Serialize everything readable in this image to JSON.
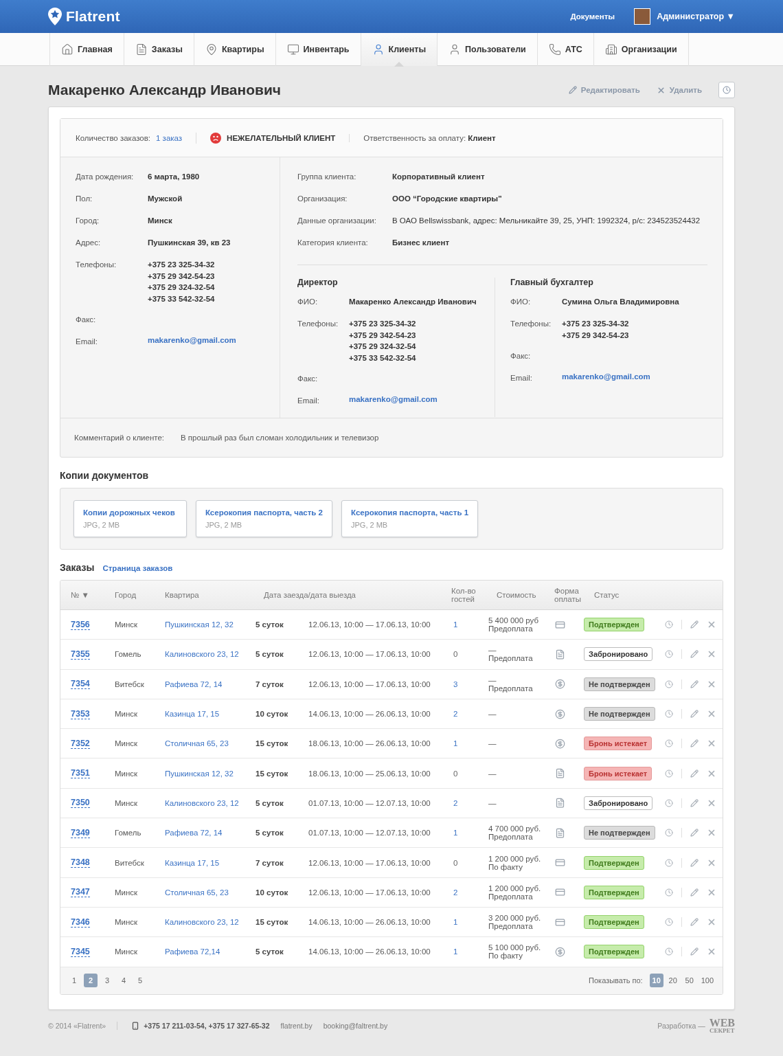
{
  "header": {
    "logo": "Flatrent",
    "documents_link": "Документы",
    "user_name": "Администратор ▼"
  },
  "nav": [
    {
      "label": "Главная",
      "kind": "home",
      "selected": false
    },
    {
      "label": "Заказы",
      "kind": "orders",
      "selected": false
    },
    {
      "label": "Квартиры",
      "kind": "apartments",
      "selected": false
    },
    {
      "label": "Инвентарь",
      "kind": "inventory",
      "selected": false
    },
    {
      "label": "Клиенты",
      "kind": "clients",
      "selected": true
    },
    {
      "label": "Пользователи",
      "kind": "users",
      "selected": false
    },
    {
      "label": "АТС",
      "kind": "telephony",
      "selected": false
    },
    {
      "label": "Организации",
      "kind": "organizations",
      "selected": false
    }
  ],
  "page": {
    "title": "Макаренко Александр Иванович",
    "actions": [
      {
        "label": "Редактировать",
        "kind": "edit"
      },
      {
        "label": "Удалить",
        "kind": "delete"
      }
    ]
  },
  "summary": {
    "orders_label": "Количество заказов:",
    "orders_value": "1 заказ",
    "warning": "НЕЖЕЛАТЕЛЬНЫЙ КЛИЕНТ",
    "payment_label": "Ответственность за оплату:",
    "payment_value": "Клиент"
  },
  "personal": [
    {
      "label": "Дата рождения:",
      "values": [
        "6 марта, 1980"
      ],
      "kind": "text"
    },
    {
      "label": "Пол:",
      "values": [
        "Мужской"
      ],
      "kind": "text"
    },
    {
      "label": "Город:",
      "values": [
        "Минск"
      ],
      "kind": "text"
    },
    {
      "label": "Адрес:",
      "values": [
        "Пушкинская 39, кв 23"
      ],
      "kind": "text"
    },
    {
      "label": "Телефоны:",
      "values": [
        "+375 23 325-34-32",
        "+375 29 342-54-23",
        "+375 29 324-32-54",
        "+375 33 542-32-54"
      ],
      "kind": "text"
    },
    {
      "label": "Факс:"
    },
    {
      "label": "Email:",
      "values": [
        "makarenko@gmail.com"
      ],
      "kind": "email"
    }
  ],
  "organization": [
    {
      "label": "Группа клиента:",
      "value": "Корпоративный клиент",
      "bold": true
    },
    {
      "label": "Организация:",
      "value": "ООО “Городские квартиры”",
      "bold": true
    },
    {
      "label": "Данные организации:",
      "value": "В ОАО Bellswissbank, адрес: Мельникайте 39, 25, УНП: 1992324, р/с: 234523524432",
      "bold": false
    },
    {
      "label": "Категория клиента:",
      "value": "Бизнес клиент",
      "bold": true
    }
  ],
  "contacts": [
    {
      "title": "Директор",
      "fields": [
        {
          "label": "ФИО:",
          "values": [
            "Макаренко Александр Иванович"
          ],
          "kind": "text"
        },
        {
          "label": "Телефоны:",
          "values": [
            "+375 23 325-34-32",
            "+375 29 342-54-23",
            "+375 29 324-32-54",
            "+375 33 542-32-54"
          ],
          "kind": "text"
        },
        {
          "label": "Факс:"
        },
        {
          "label": "Email:",
          "values": [
            "makarenko@gmail.com"
          ],
          "kind": "email"
        }
      ]
    },
    {
      "title": "Главный бухгалтер",
      "fields": [
        {
          "label": "ФИО:",
          "values": [
            "Сумина Ольга Владимировна"
          ],
          "kind": "text"
        },
        {
          "label": "Телефоны:",
          "values": [
            "+375 23 325-34-32",
            "+375 29 342-54-23"
          ],
          "kind": "text"
        },
        {
          "label": "Факс:"
        },
        {
          "label": "Email:",
          "values": [
            "makarenko@gmail.com"
          ],
          "kind": "email"
        }
      ]
    }
  ],
  "comment": {
    "label": "Комментарий о клиенте:",
    "value": "В прошлый раз был сломан холодильник и телевизор"
  },
  "documents": {
    "title": "Копии документов",
    "files": [
      {
        "name": "Копии дорожных чеков",
        "meta": "JPG, 2 MB"
      },
      {
        "name": "Ксерокопия паспорта, часть 2",
        "meta": "JPG, 2 MB"
      },
      {
        "name": "Ксерокопия паспорта, часть 1",
        "meta": "JPG, 2 MB"
      }
    ]
  },
  "orders": {
    "title": "Заказы",
    "link": "Страница заказов",
    "columns": [
      "№ ▼",
      "Город",
      "Квартира",
      "Дата заезда/дата выезда",
      "Кол-во гостей",
      "Стоимость",
      "Форма оплаты",
      "Статус"
    ],
    "rows": [
      {
        "id": "7356",
        "city": "Минск",
        "apartment": "Пушкинская 12, 32",
        "nights": "5 суток",
        "dates": "12.06.13, 10:00 — 17.06.13, 10:00",
        "guests": "1",
        "guests_link": true,
        "amount": "5 400 000 руб",
        "terms": "Предоплата",
        "payment": {
          "kind": "card"
        },
        "status": {
          "label": "Подтвержден",
          "kind": "confirmed"
        }
      },
      {
        "id": "7355",
        "city": "Гомель",
        "apartment": "Калиновского 23, 12",
        "nights": "5 суток",
        "dates": "12.06.13, 10:00 — 17.06.13, 10:00",
        "guests": "0",
        "guests_link": false,
        "amount": "—",
        "terms": "Предоплата",
        "payment": {
          "kind": "document"
        },
        "status": {
          "label": "Забронировано",
          "kind": "booked"
        }
      },
      {
        "id": "7354",
        "city": "Витебск",
        "apartment": "Рафиева 72, 14",
        "nights": "7 суток",
        "dates": "12.06.13, 10:00 — 17.06.13, 10:00",
        "guests": "3",
        "guests_link": true,
        "amount": "—",
        "terms": "Предоплата",
        "payment": {
          "kind": "coin"
        },
        "status": {
          "label": "Не подтвержден",
          "kind": "unconfirmed"
        }
      },
      {
        "id": "7353",
        "city": "Минск",
        "apartment": "Казинца 17, 15",
        "nights": "10 суток",
        "dates": "14.06.13, 10:00 — 26.06.13, 10:00",
        "guests": "2",
        "guests_link": true,
        "amount": "—",
        "payment": {
          "kind": "coin"
        },
        "status": {
          "label": "Не подтвержден",
          "kind": "unconfirmed"
        }
      },
      {
        "id": "7352",
        "city": "Минск",
        "apartment": "Столичная 65, 23",
        "nights": "15 суток",
        "dates": "18.06.13, 10:00 — 26.06.13, 10:00",
        "guests": "1",
        "guests_link": true,
        "amount": "—",
        "payment": {
          "kind": "coin"
        },
        "status": {
          "label": "Бронь истекает",
          "kind": "expiring"
        }
      },
      {
        "id": "7351",
        "city": "Минск",
        "apartment": "Пушкинская 12, 32",
        "nights": "15 суток",
        "dates": "18.06.13, 10:00 — 25.06.13, 10:00",
        "guests": "0",
        "guests_link": false,
        "amount": "—",
        "payment": {
          "kind": "document"
        },
        "status": {
          "label": "Бронь истекает",
          "kind": "expiring"
        }
      },
      {
        "id": "7350",
        "city": "Минск",
        "apartment": "Калиновского 23, 12",
        "nights": "5 суток",
        "dates": "01.07.13, 10:00 — 12.07.13, 10:00",
        "guests": "2",
        "guests_link": true,
        "amount": "—",
        "payment": {
          "kind": "document"
        },
        "status": {
          "label": "Забронировано",
          "kind": "booked"
        }
      },
      {
        "id": "7349",
        "city": "Гомель",
        "apartment": "Рафиева 72, 14",
        "nights": "5 суток",
        "dates": "01.07.13, 10:00 — 12.07.13, 10:00",
        "guests": "1",
        "guests_link": true,
        "amount": "4 700 000 руб.",
        "terms": "Предоплата",
        "payment": {
          "kind": "document"
        },
        "status": {
          "label": "Не подтвержден",
          "kind": "unconfirmed"
        }
      },
      {
        "id": "7348",
        "city": "Витебск",
        "apartment": "Казинца 17, 15",
        "nights": "7 суток",
        "dates": "12.06.13, 10:00 — 17.06.13, 10:00",
        "guests": "0",
        "guests_link": false,
        "amount": "1 200 000 руб.",
        "terms": "По факту",
        "payment": {
          "kind": "card"
        },
        "status": {
          "label": "Подтвержден",
          "kind": "confirmed"
        }
      },
      {
        "id": "7347",
        "city": "Минск",
        "apartment": "Столичная 65, 23",
        "nights": "10 суток",
        "dates": "12.06.13, 10:00 — 17.06.13, 10:00",
        "guests": "2",
        "guests_link": true,
        "amount": "1 200 000 руб.",
        "terms": "Предоплата",
        "payment": {
          "kind": "card"
        },
        "status": {
          "label": "Подтвержден",
          "kind": "confirmed"
        }
      },
      {
        "id": "7346",
        "city": "Минск",
        "apartment": "Калиновского 23, 12",
        "nights": "15 суток",
        "dates": "14.06.13, 10:00 — 26.06.13, 10:00",
        "guests": "1",
        "guests_link": true,
        "amount": "3 200 000 руб.",
        "terms": "Предоплата",
        "payment": {
          "kind": "card"
        },
        "status": {
          "label": "Подтвержден",
          "kind": "confirmed"
        }
      },
      {
        "id": "7345",
        "city": "Минск",
        "apartment": "Рафиева 72,14",
        "nights": "5 суток",
        "dates": "14.06.13, 10:00 — 26.06.13, 10:00",
        "guests": "1",
        "guests_link": true,
        "amount": "5 100 000 руб.",
        "terms": "По факту",
        "payment": {
          "kind": "coin"
        },
        "status": {
          "label": "Подтвержден",
          "kind": "confirmed"
        }
      }
    ],
    "pages": [
      {
        "label": "1",
        "selected": false
      },
      {
        "label": "2",
        "selected": true
      },
      {
        "label": "3",
        "selected": false
      },
      {
        "label": "4",
        "selected": false
      },
      {
        "label": "5",
        "selected": false
      }
    ],
    "per_page_label": "Показывать по:",
    "per_page": [
      {
        "label": "10",
        "selected": true
      },
      {
        "label": "20",
        "selected": false
      },
      {
        "label": "50",
        "selected": false
      },
      {
        "label": "100",
        "selected": false
      }
    ]
  },
  "footer": {
    "copyright": "© 2014 «Flatrent»",
    "phones": "+375 17 211-03-54, +375 17 327-65-32",
    "site": "flatrent.by",
    "email": "booking@faltrent.by",
    "credit_label": "Разработка —",
    "credit_logo_top": "WEB",
    "credit_logo_bottom": "СЕКРЕТ"
  }
}
